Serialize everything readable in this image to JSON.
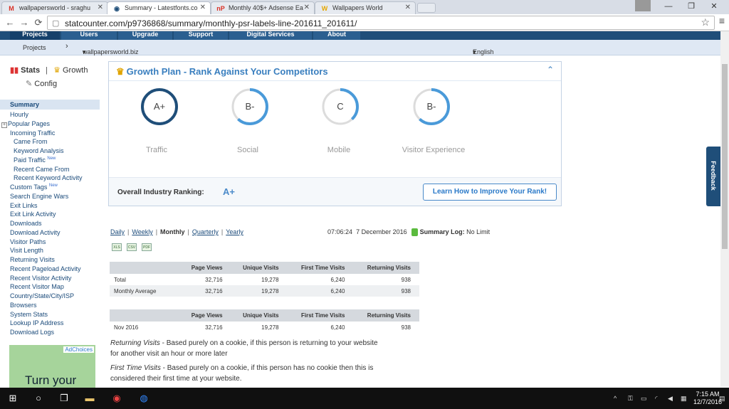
{
  "browser": {
    "tabs": [
      {
        "title": "wallpapersworld - sraghu",
        "favicon": "M",
        "favicon_color": "#d93025"
      },
      {
        "title": "Summary - Latestfonts.co",
        "favicon": "◉",
        "favicon_color": "#1f4e79"
      },
      {
        "title": "Monthly 40$+ Adsense Ea",
        "favicon": "nP",
        "favicon_color": "#d93025"
      },
      {
        "title": "Wallpapers World",
        "favicon": "W",
        "favicon_color": "#e6a700"
      }
    ],
    "close_glyph": "✕",
    "url": "statcounter.com/p9736868/summary/monthly-psr-labels-line-201611_201611/",
    "back": "←",
    "forward": "→",
    "reload": "⟳",
    "star": "☆",
    "menu": "≡",
    "min": "—",
    "max": "❐",
    "close": "✕"
  },
  "topnav": [
    "Projects",
    "Users",
    "Upgrade",
    "Support",
    "Digital Services",
    "About"
  ],
  "subnav": {
    "projects": "Projects",
    "arrow": "›",
    "site": "wallpapersworld.biz",
    "site_caret": "▾",
    "language": "English",
    "language_caret": "▾"
  },
  "sidebar": {
    "stats": "Stats",
    "sep": "|",
    "growth": "Growth",
    "config": "Config",
    "summary": "Summary",
    "items": [
      {
        "label": "Hourly",
        "sub": false
      },
      {
        "label": "Popular Pages",
        "sub": false,
        "expand": "+"
      },
      {
        "label": "Incoming Traffic",
        "sub": false
      },
      {
        "label": "Came From",
        "sub": true
      },
      {
        "label": "Keyword Analysis",
        "sub": true
      },
      {
        "label": "Paid Traffic",
        "sub": true,
        "new": "New"
      },
      {
        "label": "Recent Came From",
        "sub": true
      },
      {
        "label": "Recent Keyword Activity",
        "sub": true
      },
      {
        "label": "Custom Tags",
        "sub": false,
        "new": "New"
      },
      {
        "label": "Search Engine Wars",
        "sub": false
      },
      {
        "label": "Exit Links",
        "sub": false
      },
      {
        "label": "Exit Link Activity",
        "sub": false
      },
      {
        "label": "Downloads",
        "sub": false
      },
      {
        "label": "Download Activity",
        "sub": false
      },
      {
        "label": "Visitor Paths",
        "sub": false
      },
      {
        "label": "Visit Length",
        "sub": false
      },
      {
        "label": "Returning Visits",
        "sub": false
      },
      {
        "label": "Recent Pageload Activity",
        "sub": false
      },
      {
        "label": "Recent Visitor Activity",
        "sub": false
      },
      {
        "label": "Recent Visitor Map",
        "sub": false
      },
      {
        "label": "Country/State/City/ISP",
        "sub": false
      },
      {
        "label": "Browsers",
        "sub": false
      },
      {
        "label": "System Stats",
        "sub": false
      },
      {
        "label": "Lookup IP Address",
        "sub": false
      },
      {
        "label": "Download Logs",
        "sub": false
      }
    ],
    "ad": {
      "choices": "AdChoices",
      "text": "Turn your"
    }
  },
  "growth": {
    "title": "Growth Plan - Rank Against Your Competitors",
    "collapse_icon": "⌃",
    "grades": [
      {
        "grade": "A+",
        "category": "Traffic",
        "level": 1.0,
        "color": "#1f4e79"
      },
      {
        "grade": "B-",
        "category": "Social",
        "level": 0.62,
        "color": "#4a9ad9"
      },
      {
        "grade": "C",
        "category": "Mobile",
        "level": 0.38,
        "color": "#4a9ad9"
      },
      {
        "grade": "B-",
        "category": "Visitor Experience",
        "level": 0.62,
        "color": "#4a9ad9"
      }
    ],
    "overall_label": "Overall Industry Ranking:",
    "overall_value": "A+",
    "learn_button": "Learn How to Improve Your Rank!"
  },
  "feedback": "Feedback",
  "periods": {
    "daily": "Daily",
    "weekly": "Weekly",
    "monthly": "Monthly",
    "quarterly": "Quarterly",
    "yearly": "Yearly",
    "sep": "|"
  },
  "timeinfo": {
    "time": "07:06:24",
    "date": "7 December 2016",
    "log_label": "Summary Log:",
    "log_value": "No Limit"
  },
  "exports": [
    "XLS",
    "CSV",
    "PDF"
  ],
  "table1": {
    "headers": [
      "",
      "Page Views",
      "Unique Visits",
      "First Time Visits",
      "Returning Visits"
    ],
    "rows": [
      [
        "Total",
        "32,716",
        "19,278",
        "6,240",
        "938"
      ],
      [
        "Monthly Average",
        "32,716",
        "19,278",
        "6,240",
        "938"
      ]
    ]
  },
  "table2": {
    "headers": [
      "",
      "Page Views",
      "Unique Visits",
      "First Time Visits",
      "Returning Visits"
    ],
    "rows": [
      [
        "Nov 2016",
        "32,716",
        "19,278",
        "6,240",
        "938"
      ]
    ]
  },
  "definitions": {
    "returning_term": "Returning Visits",
    "returning_text": " - Based purely on a cookie, if this person is returning to your website for another visit an hour or more later",
    "first_term": "First Time Visits",
    "first_text": " - Based purely on a cookie, if this person has no cookie then this is considered their first time at your website."
  },
  "taskbar": {
    "clock_time": "7:15 AM",
    "clock_date": "12/7/2016"
  }
}
